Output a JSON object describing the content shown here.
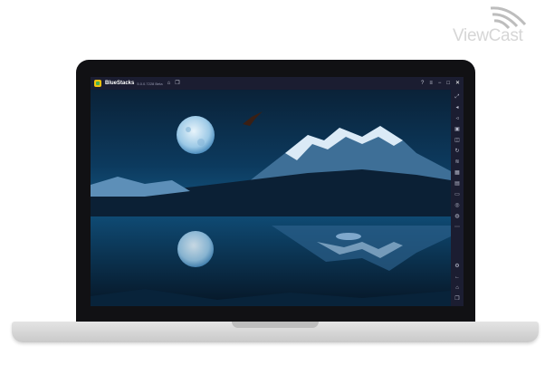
{
  "watermark": {
    "text": "ViewCast"
  },
  "window": {
    "app_name": "BlueStacks",
    "app_version": "5.0.0.7228 Beta",
    "titlebar_icons": [
      "home-icon",
      "multi-instance-icon"
    ],
    "controls": [
      "help-icon",
      "menu-icon",
      "minimize-icon",
      "maximize-icon",
      "close-icon"
    ]
  },
  "sidebar": {
    "top_icons": [
      "fullscreen-icon",
      "volume-up-icon",
      "volume-down-icon",
      "media-icon",
      "screenshot-icon",
      "rotate-icon",
      "shake-icon",
      "macro-icon",
      "camera-icon",
      "folder-icon",
      "location-icon",
      "eco-mode-icon",
      "more-icon"
    ],
    "bottom_icons": [
      "settings-icon",
      "back-icon",
      "home-icon",
      "recent-apps-icon"
    ]
  },
  "wallpaper": {
    "subject": "night lake",
    "colors": {
      "sky": "#0c3a5e",
      "moon": "#cfe6f5",
      "mountain": "#9fc2e0",
      "water": "#0b2e4f"
    }
  }
}
